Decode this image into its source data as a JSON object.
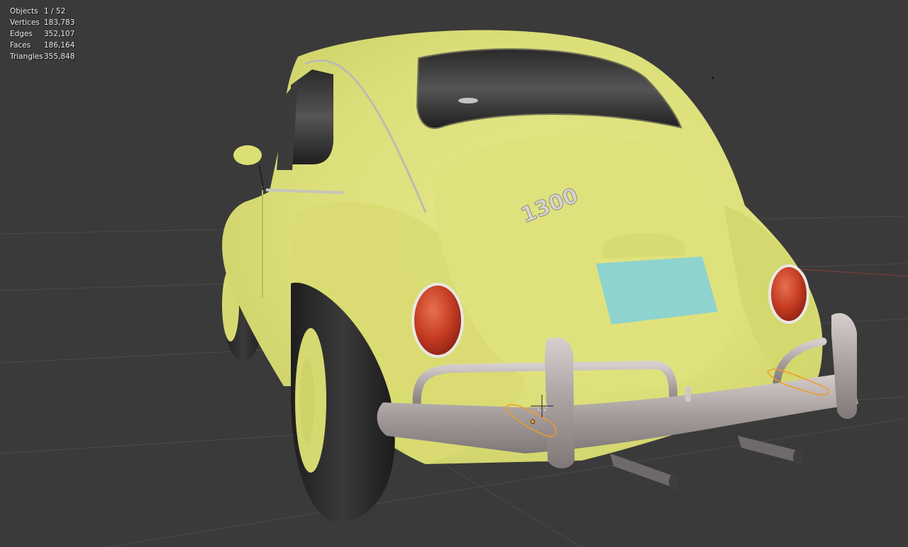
{
  "viewport": {
    "background": "#3a3a3a",
    "car_color": "#e2e57f",
    "chrome_color": "#b3aaa8",
    "taillight_color": "#c43b22",
    "plate_color": "#8fd3cf",
    "selection_outline": "#f29a26",
    "badge_text": "1300"
  },
  "stats": [
    {
      "label": "Objects",
      "value": "1 / 52"
    },
    {
      "label": "Vertices",
      "value": "183,783"
    },
    {
      "label": "Edges",
      "value": "352,107"
    },
    {
      "label": "Faces",
      "value": "186,164"
    },
    {
      "label": "Triangles",
      "value": "355,848"
    }
  ]
}
